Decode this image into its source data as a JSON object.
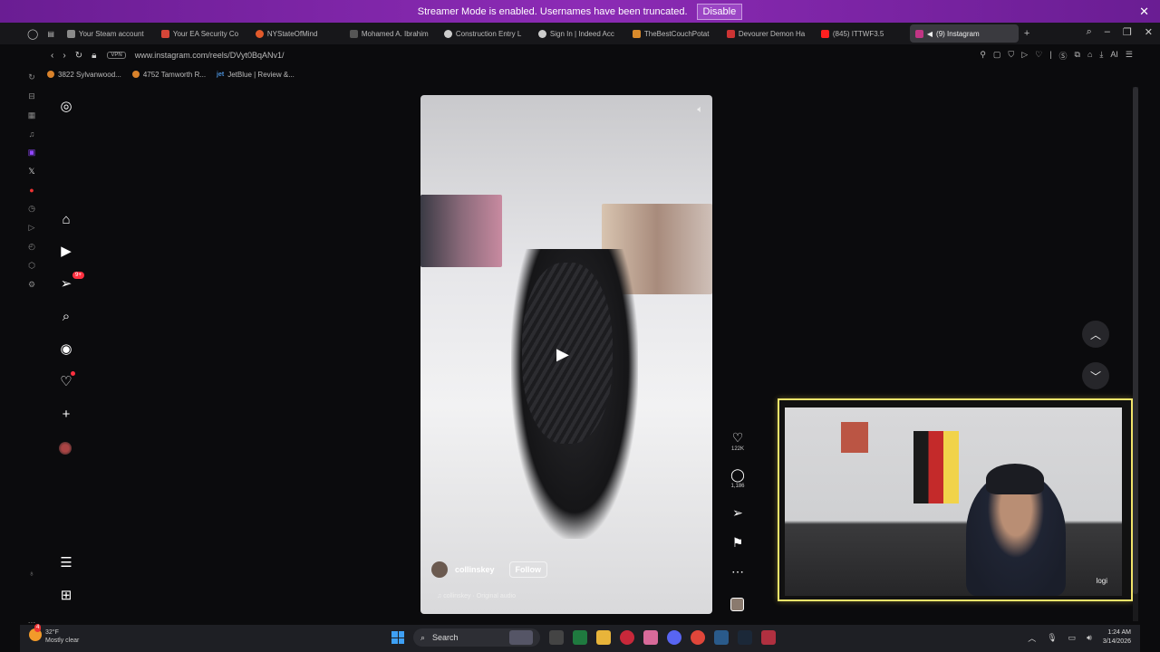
{
  "banner": {
    "text": "Streamer Mode is enabled. Usernames have been truncated.",
    "button": "Disable"
  },
  "tabs": [
    {
      "label": "Your Steam account",
      "color": "#8a8a8a"
    },
    {
      "label": "Your EA Security Co",
      "color": "#d44638"
    },
    {
      "label": "NYStateOfMind",
      "color": "#e25a2b"
    },
    {
      "label": "Mohamed A. Ibrahim",
      "color": "#555"
    },
    {
      "label": "Construction Entry L",
      "color": "#ccc"
    },
    {
      "label": "Sign In | Indeed Acc",
      "color": "#ccc"
    },
    {
      "label": "TheBestCouchPotat",
      "color": "#d98a2b"
    },
    {
      "label": "Devourer Demon Ha",
      "color": "#cc3333"
    },
    {
      "label": "(845) ITTWF3.5",
      "color": "#ff2020"
    },
    {
      "label": "(9) Instagram",
      "color": "#c13584",
      "active": true
    }
  ],
  "address": {
    "vpn": "VPN",
    "url": "www.instagram.com/reels/DVyt0BqANv1/",
    "ai": "AI"
  },
  "bookmarks": [
    "3822 Sylvanwood...",
    "4752 Tamworth R...",
    "JetBlue | Review &..."
  ],
  "nav": {
    "notifications_badge": "9+"
  },
  "reel": {
    "username": "collinskey",
    "follow": "Follow",
    "audio": "collinskey · Original audio",
    "likes": "122K",
    "comments": "1,186"
  },
  "webcam": {
    "label": "logi"
  },
  "taskbar": {
    "weather_temp": "32°F",
    "weather_desc": "Mostly clear",
    "weather_badge": "4",
    "search": "Search",
    "time": "1:24 AM",
    "date": "3/14/2026"
  }
}
